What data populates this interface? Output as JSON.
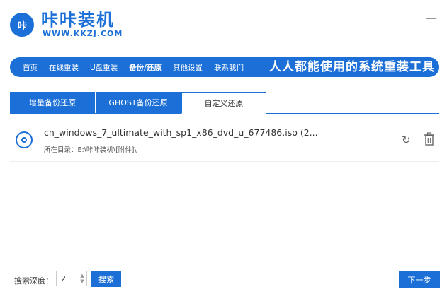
{
  "header": {
    "logo_text": "咔",
    "brand_name": "咔咔装机",
    "brand_url": "WWW.KKZJ.COM",
    "minimize": "—"
  },
  "nav": {
    "items": [
      {
        "label": "首页"
      },
      {
        "label": "在线重装"
      },
      {
        "label": "U盘重装"
      },
      {
        "label": "备份/还原"
      },
      {
        "label": "其他设置"
      },
      {
        "label": "联系我们"
      }
    ],
    "slogan": "人人都能使用的系统重装工具"
  },
  "tabs": [
    {
      "label": "增量备份还原"
    },
    {
      "label": "GHOST备份还原"
    },
    {
      "label": "自定义还原"
    }
  ],
  "file": {
    "name": "cn_windows_7_ultimate_with_sp1_x86_dvd_u_677486.iso (2...",
    "directory": "所在目录：E:\\咔咔装机\\[附件]\\"
  },
  "footer": {
    "search_depth_label": "搜索深度：",
    "search_depth_value": "2",
    "search_button": "搜索",
    "next_button": "下一步"
  },
  "colors": {
    "accent": "#1c6fd6"
  }
}
